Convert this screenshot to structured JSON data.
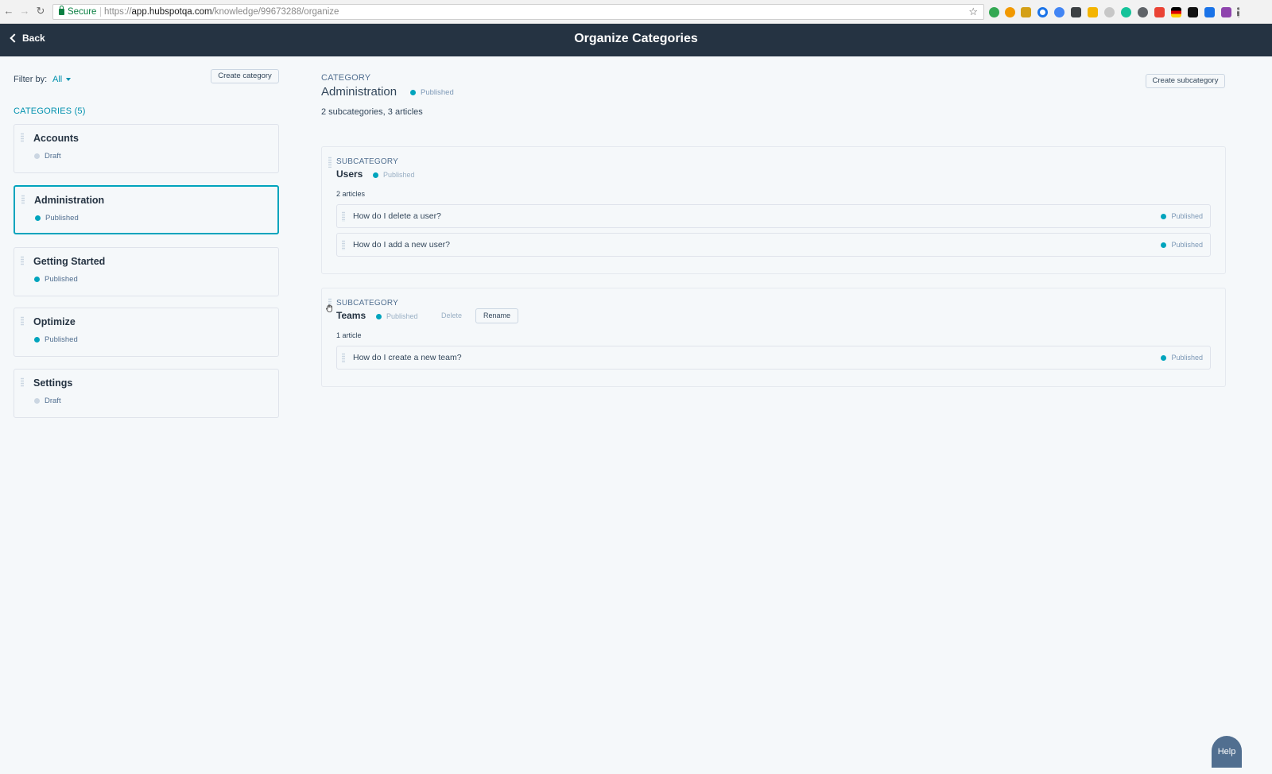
{
  "browser": {
    "secure_label": "Secure",
    "url_scheme": "https://",
    "url_host": "app.hubspotqa.com",
    "url_path": "/knowledge/99673288/organize"
  },
  "header": {
    "back_label": "Back",
    "title": "Organize Categories"
  },
  "sidebar": {
    "filter_label": "Filter by:",
    "filter_value": "All",
    "create_category_label": "Create category",
    "categories_heading": "CATEGORIES (5)",
    "categories": [
      {
        "name": "Accounts",
        "status": "Draft"
      },
      {
        "name": "Administration",
        "status": "Published"
      },
      {
        "name": "Getting Started",
        "status": "Published"
      },
      {
        "name": "Optimize",
        "status": "Published"
      },
      {
        "name": "Settings",
        "status": "Draft"
      }
    ]
  },
  "main": {
    "label": "CATEGORY",
    "title": "Administration",
    "status": "Published",
    "summary": "2 subcategories, 3 articles",
    "create_subcategory_label": "Create subcategory",
    "subcategories": [
      {
        "label": "SUBCATEGORY",
        "name": "Users",
        "status": "Published",
        "count": "2 articles",
        "articles": [
          {
            "title": "How do I delete a user?",
            "status": "Published"
          },
          {
            "title": "How do I add a new user?",
            "status": "Published"
          }
        ]
      },
      {
        "label": "SUBCATEGORY",
        "name": "Teams",
        "status": "Published",
        "delete_label": "Delete",
        "rename_label": "Rename",
        "count": "1 article",
        "articles": [
          {
            "title": "How do I create a new team?",
            "status": "Published"
          }
        ]
      }
    ]
  },
  "help_label": "Help",
  "colors": {
    "header_bg": "#253342",
    "published": "#00a4bd",
    "draft": "#cbd6e2",
    "link": "#0091ae"
  }
}
